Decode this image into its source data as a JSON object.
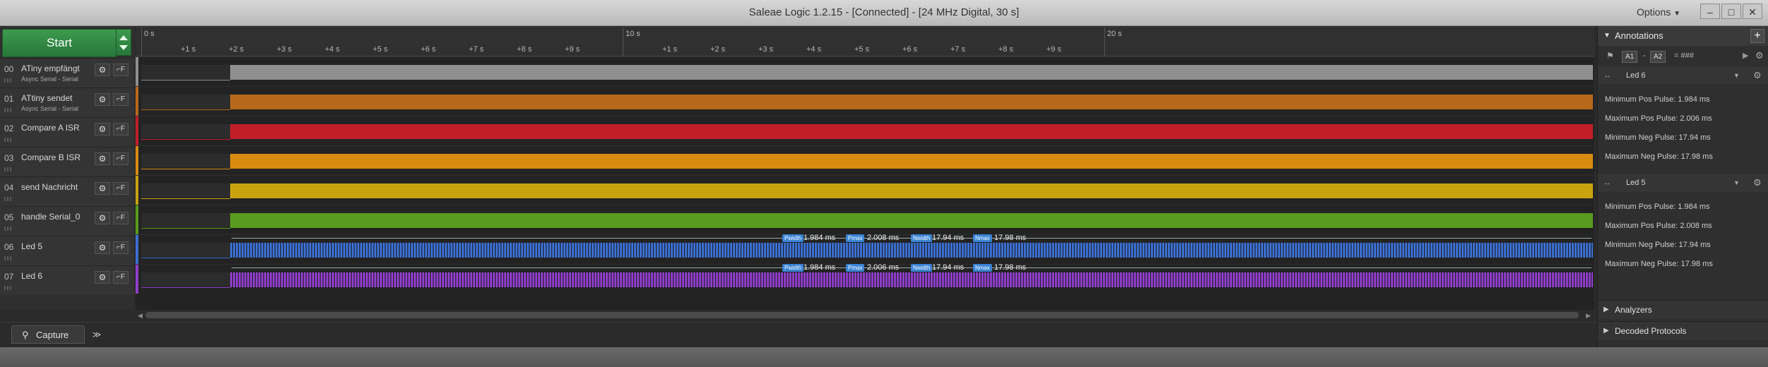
{
  "window": {
    "title": "Saleae Logic 1.2.15 - [Connected] - [24 MHz Digital, 30 s]",
    "options_label": "Options",
    "minimize_label": "–",
    "maximize_label": "□",
    "close_label": "✕"
  },
  "toolbar": {
    "start_label": "Start"
  },
  "channels": [
    {
      "num": "00",
      "name": "ATiny empfängt",
      "sub": "Async Serial - Serial",
      "color": "#8f8f8f"
    },
    {
      "num": "01",
      "name": "ATtiny sendet",
      "sub": "Async Serial - Serial",
      "color": "#b8681b"
    },
    {
      "num": "02",
      "name": "Compare A ISR",
      "sub": "",
      "color": "#c21e2a"
    },
    {
      "num": "03",
      "name": "Compare B ISR",
      "sub": "",
      "color": "#d98a10"
    },
    {
      "num": "04",
      "name": "send Nachricht",
      "sub": "",
      "color": "#c9a210"
    },
    {
      "num": "05",
      "name": "handle Serial_0",
      "sub": "",
      "color": "#5a9a1e"
    },
    {
      "num": "06",
      "name": "Led 5",
      "sub": "",
      "color": "#3b6fd1"
    },
    {
      "num": "07",
      "name": "Led 6",
      "sub": "",
      "color": "#8e3ec9"
    }
  ],
  "ruler": {
    "major": [
      "0 s",
      "10 s",
      "20 s"
    ],
    "minor": [
      "+1 s",
      "+2 s",
      "+3 s",
      "+4 s",
      "+5 s",
      "+6 s",
      "+7 s",
      "+8 s",
      "+9 s"
    ]
  },
  "measurements": [
    {
      "channel": "Led 5",
      "tags": [
        "Pwidth",
        "Pmax",
        "Nwidth",
        "Nmax"
      ],
      "values": [
        "1.984 ms",
        "2.008 ms",
        "17.94 ms",
        "17.98 ms"
      ]
    },
    {
      "channel": "Led 6",
      "tags": [
        "Pwidth",
        "Pmax",
        "Nwidth",
        "Nmax"
      ],
      "values": [
        "1.984 ms",
        "2.006 ms",
        "17.94 ms",
        "17.98 ms"
      ]
    }
  ],
  "bottom": {
    "capture_label": "Capture",
    "more_label": "≫"
  },
  "annotations": {
    "header": "Annotations",
    "add_label": "+",
    "toolbar": {
      "a1": "A1",
      "a2": "A2",
      "delta": "-",
      "eq": "= ###"
    },
    "groups": [
      {
        "name": "Led 6",
        "items": [
          "Minimum Pos Pulse: 1.984 ms",
          "Maximum Pos Pulse: 2.006 ms",
          "Minimum Neg Pulse: 17.94 ms",
          "Maximum Neg Pulse: 17.98 ms"
        ]
      },
      {
        "name": "Led 5",
        "items": [
          "Minimum Pos Pulse: 1.984 ms",
          "Maximum Pos Pulse: 2.008 ms",
          "Minimum Neg Pulse: 17.94 ms",
          "Maximum Neg Pulse: 17.98 ms"
        ]
      }
    ]
  },
  "analyzers": {
    "label": "Analyzers"
  },
  "decoded": {
    "label": "Decoded Protocols"
  }
}
